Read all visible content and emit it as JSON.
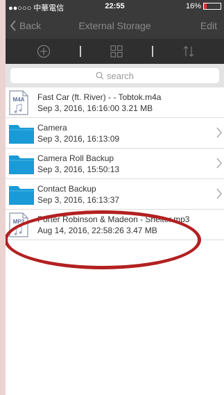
{
  "status": {
    "carrier": "●●○○○ 中華電信",
    "time": "22:55",
    "battery": "16%",
    "battery_level": 0.16
  },
  "nav": {
    "back_label": "Back",
    "title": "External Storage",
    "edit_label": "Edit"
  },
  "toolbar": {
    "icons": [
      "add-circle-icon",
      "grid-icon",
      "sort-icon"
    ]
  },
  "search": {
    "placeholder": "search"
  },
  "files": [
    {
      "type": "m4a",
      "badge": "M4A",
      "name": "Fast Car (ft. River) - - Tobtok.m4a",
      "meta": "Sep 3, 2016, 16:16:00  3.21 MB"
    },
    {
      "type": "folder",
      "name": "Camera",
      "meta": "Sep 3, 2016, 16:13:09"
    },
    {
      "type": "folder",
      "name": "Camera Roll Backup",
      "meta": "Sep 3, 2016, 15:50:13"
    },
    {
      "type": "folder",
      "name": "Contact Backup",
      "meta": "Sep 3, 2016, 16:13:37"
    },
    {
      "type": "mp3",
      "badge": "MP3",
      "name": "Porter Robinson & Madeon - Shelter.mp3",
      "meta": "Aug 14, 2016, 22:58:26  3.47 MB"
    }
  ],
  "colors": {
    "folder": "#1A9AD6",
    "annotation": "#B32020",
    "bars": "#3A3A3A"
  }
}
